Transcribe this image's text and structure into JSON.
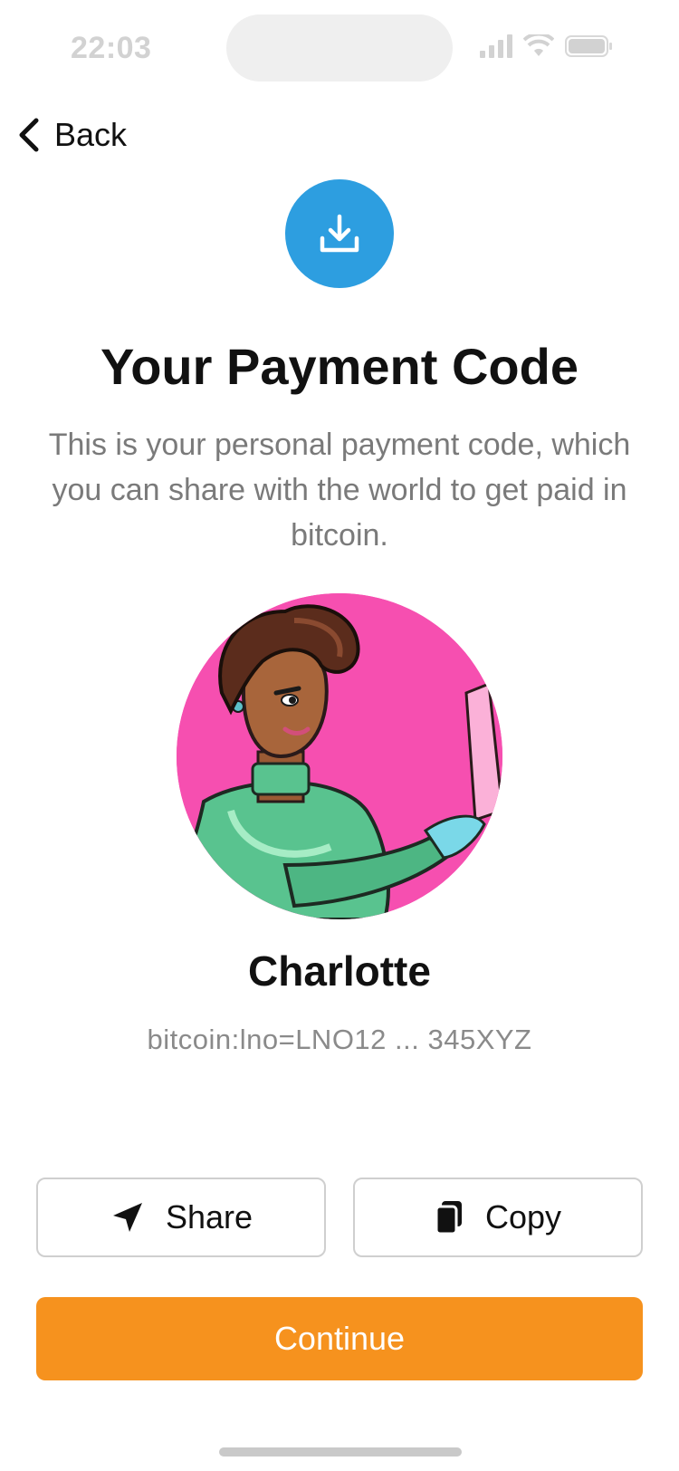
{
  "status_bar": {
    "time": "22:03"
  },
  "nav": {
    "back_label": "Back"
  },
  "header": {
    "title": "Your Payment Code",
    "subtitle": "This is your personal payment code, which you can share with the world to get paid in bitcoin."
  },
  "profile": {
    "name": "Charlotte",
    "payment_code": "bitcoin:lno=LNO12 ... 345XYZ"
  },
  "actions": {
    "share_label": "Share",
    "copy_label": "Copy",
    "continue_label": "Continue"
  },
  "colors": {
    "accent_blue": "#2d9ee0",
    "primary_orange": "#f6921e",
    "avatar_bg": "#f64fb0"
  },
  "icons": {
    "hero": "download-icon",
    "back": "chevron-left-icon",
    "share": "send-icon",
    "copy": "copy-icon"
  }
}
